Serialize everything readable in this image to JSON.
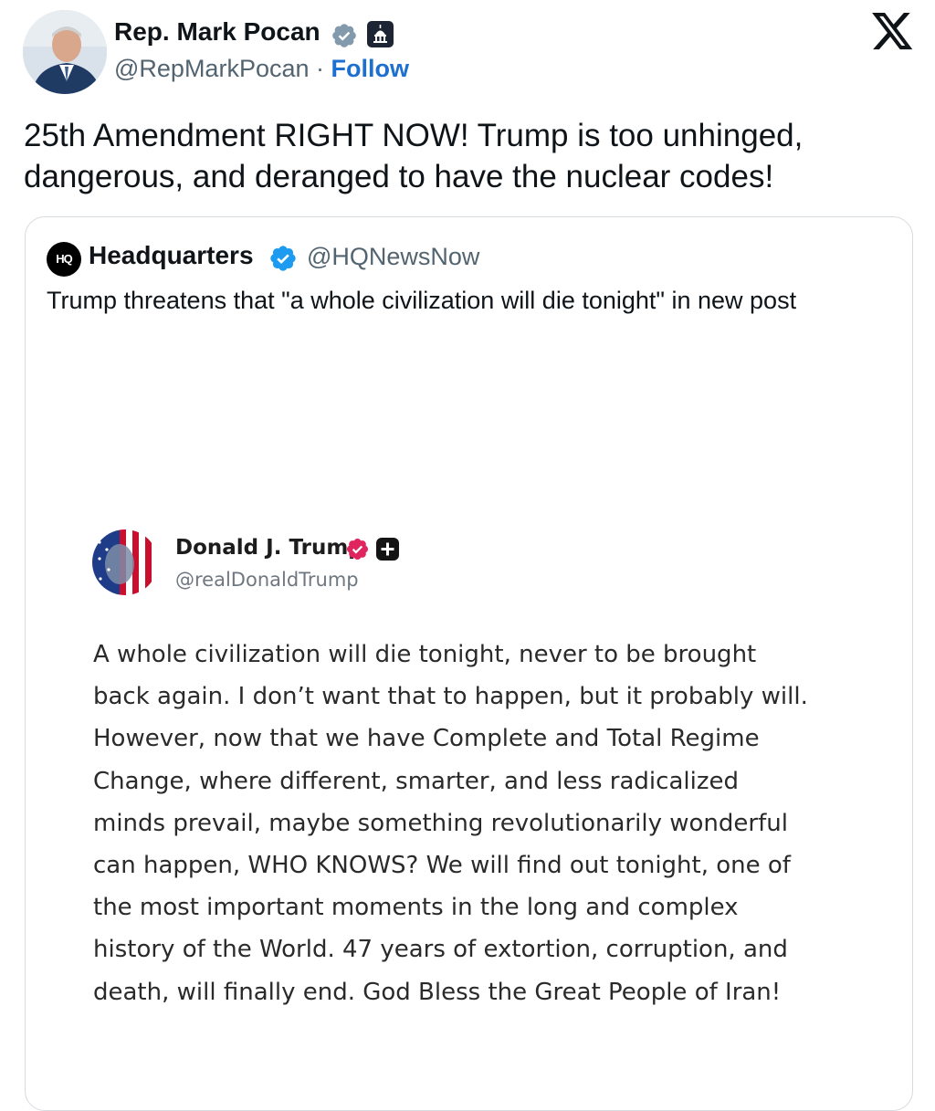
{
  "author": {
    "name": "Rep. Mark Pocan",
    "handle": "@RepMarkPocan",
    "separator": "·",
    "follow_label": "Follow",
    "verified_badge": "grey-verified-check-icon",
    "affiliation_badge": "capitol-building-icon"
  },
  "platform_icon": "x-logo-icon",
  "tweet": {
    "lines": [
      "25th Amendment RIGHT NOW! Trump is too unhinged,",
      "dangerous, and deranged to have the nuclear codes!"
    ]
  },
  "quoted": {
    "logo_text": "HQ",
    "name": "Headquarters",
    "handle": "@HQNewsNow",
    "verified_badge": "blue-verified-check-icon",
    "text": "Trump threatens that \"a whole civilization will die tonight\" in new post",
    "embedded_post": {
      "name": "Donald J. Trump",
      "handle": "@realDonaldTrump",
      "verified_badge": "red-verified-check-icon",
      "extra_badge": "plus-icon",
      "lines": [
        "A whole civilization will die tonight, never to be brought",
        "back again. I don’t want that to happen, but it probably will.",
        "However, now that we have Complete and Total Regime",
        "Change, where different, smarter, and less radicalized",
        "minds prevail, maybe something revolutionarily wonderful",
        "can happen, WHO KNOWS? We will find out tonight, one of",
        "the most important moments in the long and complex",
        "history of the World. 47 years of extortion, corruption, and",
        "death, will finally end. God Bless the Great People of Iran!"
      ]
    }
  },
  "colors": {
    "text": "#0f1419",
    "secondary": "#536471",
    "follow": "#1d6fd0",
    "verified_blue": "#1d9bf0",
    "verified_grey": "#829aab",
    "verified_red": "#e0245e"
  }
}
